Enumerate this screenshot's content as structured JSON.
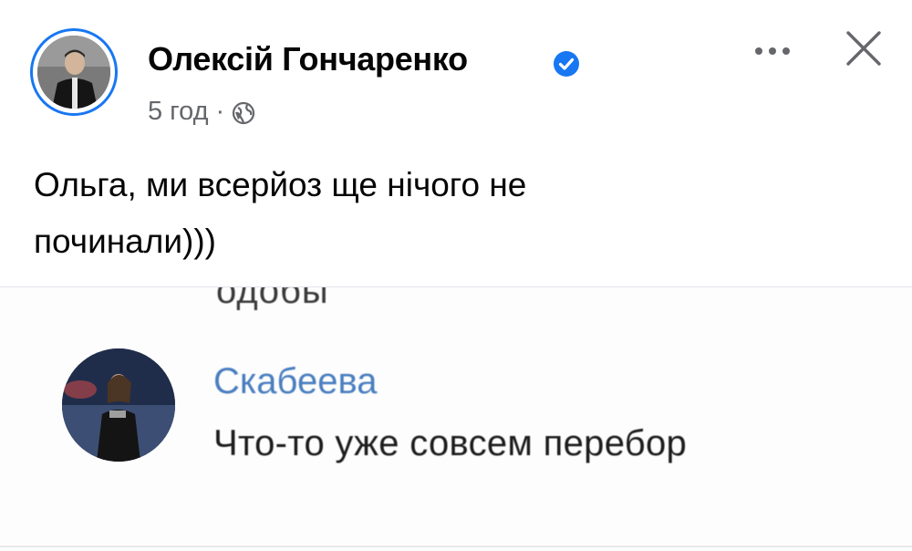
{
  "post": {
    "author": "Олексій Гончаренко",
    "time": "5 год",
    "separator": "·",
    "privacy_icon": "globe-icon",
    "verified_icon": "verified-badge-icon",
    "text_line1": "Ольга, ми всерйоз ще нічого не",
    "text_line2": "починали)))"
  },
  "header_actions": {
    "more_icon": "more-options-icon",
    "close_icon": "close-icon"
  },
  "embedded_screenshot": {
    "cut_text": "одобы",
    "name": "Скабеева",
    "message": "Что-то уже совсем перебор"
  },
  "colors": {
    "accent": "#1877f2",
    "secondary_text": "#65676b",
    "embed_name": "#4a7ec0"
  }
}
